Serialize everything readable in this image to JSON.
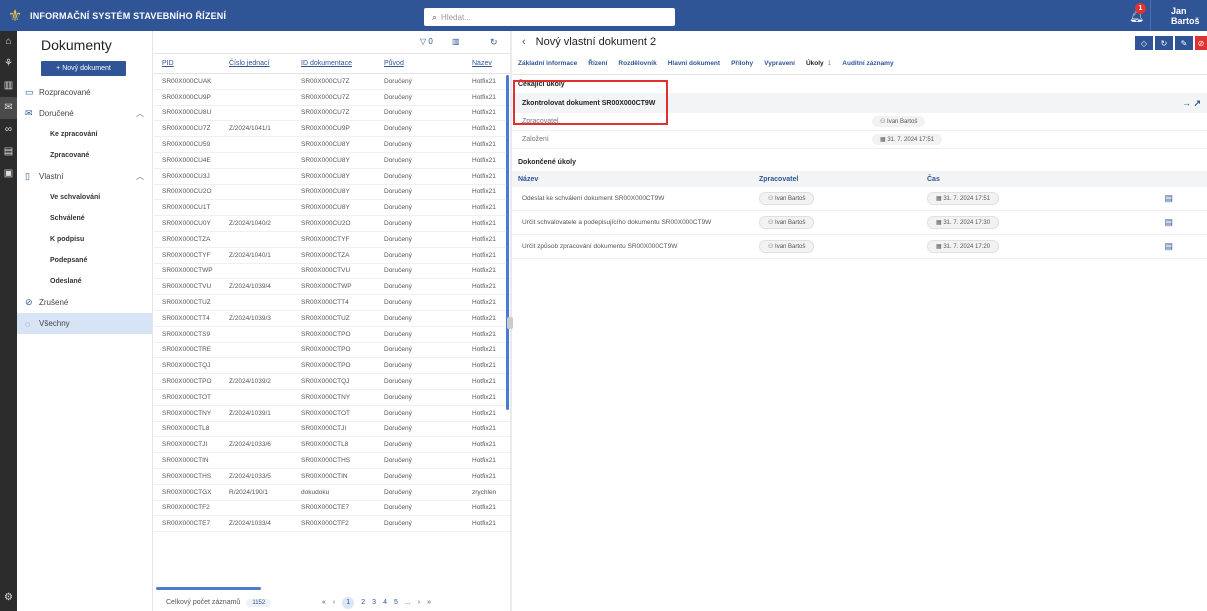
{
  "app": {
    "title": "INFORMAČNÍ SYSTÉM STAVEBNÍHO ŘÍZENÍ",
    "search_placeholder": "Hledat...",
    "notifications": "1",
    "user": "Jan Bartoš"
  },
  "sidebar": {
    "title": "Dokumenty",
    "new_button": "+ Nový dokument",
    "items": [
      {
        "label": "Rozpracované"
      },
      {
        "label": "Doručené"
      },
      {
        "label": "Ke zpracování"
      },
      {
        "label": "Zpracované"
      },
      {
        "label": "Vlastní"
      },
      {
        "label": "Ve schvalování"
      },
      {
        "label": "Schválené"
      },
      {
        "label": "K podpisu"
      },
      {
        "label": "Podepsané"
      },
      {
        "label": "Odeslané"
      },
      {
        "label": "Zrušené"
      },
      {
        "label": "Všechny"
      }
    ]
  },
  "list": {
    "filter_count": "0",
    "columns": [
      "PID",
      "Číslo jednací",
      "ID dokumentace",
      "Původ",
      "Název"
    ],
    "rows": [
      [
        "SR00X000CUAK",
        "",
        "SR00X000CU7Z",
        "Doručený",
        "Hotfix21"
      ],
      [
        "SR00X000CU9P",
        "",
        "SR00X000CU7Z",
        "Doručený",
        "Hotfix21"
      ],
      [
        "SR00X000CU8U",
        "",
        "SR00X000CU7Z",
        "Doručený",
        "Hotfix21"
      ],
      [
        "SR00X000CU7Z",
        "Z/2024/1041/1",
        "SR00X000CU9P",
        "Doručený",
        "Hotfix21"
      ],
      [
        "SR00X000CU59",
        "",
        "SR00X000CU8Y",
        "Doručený",
        "Hotfix21"
      ],
      [
        "SR00X000CU4E",
        "",
        "SR00X000CU8Y",
        "Doručený",
        "Hotfix21"
      ],
      [
        "SR00X000CU3J",
        "",
        "SR00X000CU8Y",
        "Doručený",
        "Hotfix21"
      ],
      [
        "SR00X000CU2O",
        "",
        "SR00X000CU8Y",
        "Doručený",
        "Hotfix21"
      ],
      [
        "SR00X000CU1T",
        "",
        "SR00X000CU8Y",
        "Doručený",
        "Hotfix21"
      ],
      [
        "SR00X000CU0Y",
        "Z/2024/1040/2",
        "SR00X000CU2O",
        "Doručený",
        "Hotfix21"
      ],
      [
        "SR00X000CTZA",
        "",
        "SR00X000CTYF",
        "Doručený",
        "Hotfix21"
      ],
      [
        "SR00X000CTYF",
        "Z/2024/1040/1",
        "SR00X000CTZA",
        "Doručený",
        "Hotfix21"
      ],
      [
        "SR00X000CTWP",
        "",
        "SR00X000CTVU",
        "Doručený",
        "Hotfix21"
      ],
      [
        "SR00X000CTVU",
        "Z/2024/1039/4",
        "SR00X000CTWP",
        "Doručený",
        "Hotfix21"
      ],
      [
        "SR00X000CTUZ",
        "",
        "SR00X000CTT4",
        "Doručený",
        "Hotfix21"
      ],
      [
        "SR00X000CTT4",
        "Z/2024/1039/3",
        "SR00X000CTUZ",
        "Doručený",
        "Hotfix21"
      ],
      [
        "SR00X000CTS9",
        "",
        "SR00X000CTPO",
        "Doručený",
        "Hotfix21"
      ],
      [
        "SR00X000CTRE",
        "",
        "SR00X000CTPO",
        "Doručený",
        "Hotfix21"
      ],
      [
        "SR00X000CTQJ",
        "",
        "SR00X000CTPO",
        "Doručený",
        "Hotfix21"
      ],
      [
        "SR00X000CTPO",
        "Z/2024/1039/2",
        "SR00X000CTQJ",
        "Doručený",
        "Hotfix21"
      ],
      [
        "SR00X000CTOT",
        "",
        "SR00X000CTNY",
        "Doručený",
        "Hotfix21"
      ],
      [
        "SR00X000CTNY",
        "Z/2024/1039/1",
        "SR00X000CTOT",
        "Doručený",
        "Hotfix21"
      ],
      [
        "SR00X000CTL8",
        "",
        "SR00X000CTJI",
        "Doručený",
        "Hotfix21"
      ],
      [
        "SR00X000CTJI",
        "Z/2024/1033/6",
        "SR00X000CTL8",
        "Doručený",
        "Hotfix21"
      ],
      [
        "SR00X000CTIN",
        "",
        "SR00X000CTHS",
        "Doručený",
        "Hotfix21"
      ],
      [
        "SR00X000CTHS",
        "Z/2024/1033/5",
        "SR00X000CTIN",
        "Doručený",
        "Hotfix21"
      ],
      [
        "SR00X000CTGX",
        "R/2024/190/1",
        "dokudoku",
        "Doručený",
        "zrychlen"
      ],
      [
        "SR00X000CTF2",
        "",
        "SR00X000CTE7",
        "Doručený",
        "Hotfix21"
      ],
      [
        "SR00X000CTE7",
        "Z/2024/1033/4",
        "SR00X000CTF2",
        "Doručený",
        "Hotfix21"
      ]
    ],
    "total_label": "Celkový počet záznamů",
    "total": "1152",
    "pages": [
      "1",
      "2",
      "3",
      "4",
      "5",
      "..."
    ]
  },
  "detail": {
    "title": "Nový vlastní dokument 2",
    "tabs": [
      "Základní informace",
      "Řízení",
      "Rozdělovník",
      "Hlavní dokument",
      "Přílohy",
      "Vypravení",
      "Úkoly",
      "Auditní záznamy"
    ],
    "tasks_count": "1",
    "pending_title": "Čekající úkoly",
    "pending_task": "Zkontrolovat dokument SR00X000CT9W",
    "fields": [
      {
        "label": "Zpracovatel",
        "value": "Ivan Bartoš"
      },
      {
        "label": "Založení",
        "value": "31. 7. 2024 17:51"
      }
    ],
    "done_title": "Dokončené úkoly",
    "done_cols": [
      "Název",
      "Zpracovatel",
      "Čas"
    ],
    "done": [
      {
        "name": "Odeslat ke schválení dokument SR00X000CT9W",
        "who": "Ivan Bartoš",
        "time": "31. 7. 2024 17:51"
      },
      {
        "name": "Určit schvalovatele a podepisujícího dokumentu SR00X000CT9W",
        "who": "Ivan Bartoš",
        "time": "31. 7. 2024 17:30"
      },
      {
        "name": "Určit způsob zpracování dokumentu SR00X000CT9W",
        "who": "Ivan Bartoš",
        "time": "31. 7. 2024 17:20"
      }
    ]
  }
}
